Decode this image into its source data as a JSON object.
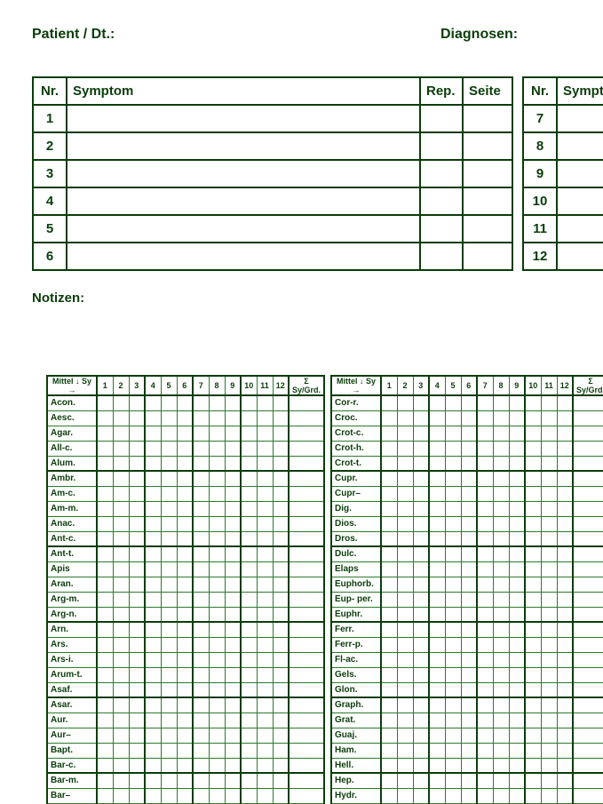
{
  "header": {
    "patient_label": "Patient / Dt.:",
    "diagnosen_label": "Diagnosen:"
  },
  "symptom_table": {
    "headers": {
      "nr": "Nr.",
      "symptom": "Symptom",
      "rep": "Rep.",
      "seite": "Seite"
    },
    "left_rows": [
      "1",
      "2",
      "3",
      "4",
      "5",
      "6"
    ],
    "right_rows": [
      "7",
      "8",
      "9",
      "10",
      "11",
      "12"
    ]
  },
  "notes_label": "Notizen:",
  "remedy": {
    "col_header_name": "Mittel ↓ Sy →",
    "num_headers": [
      "1",
      "2",
      "3",
      "4",
      "5",
      "6",
      "7",
      "8",
      "9",
      "10",
      "11",
      "12"
    ],
    "sum_header": "Σ Sy/Grd.",
    "col1": [
      "Acon.",
      "Aesc.",
      "Agar.",
      "All-c.",
      "Alum.",
      "Ambr.",
      "Am-c.",
      "Am-m.",
      "Anac.",
      "Ant-c.",
      "Ant-t.",
      "Apis",
      "Aran.",
      "Arg-m.",
      "Arg-n.",
      "Arn.",
      "Ars.",
      "Ars-i.",
      "Arum-t.",
      "Asaf.",
      "Asar.",
      "Aur.",
      "Aur–",
      "Bapt.",
      "Bar-c.",
      "Bar-m.",
      "Bar–"
    ],
    "col2": [
      "Cor-r.",
      "Croc.",
      "Crot-c.",
      "Crot-h.",
      "Crot-t.",
      "Cupr.",
      "Cupr–",
      "Dig.",
      "Dios.",
      "Dros.",
      "Dulc.",
      "Elaps",
      "Euphorb.",
      "Eup- per.",
      "Euphr.",
      "Ferr.",
      "Ferr-p.",
      "Fl-ac.",
      "Gels.",
      "Glon.",
      "Graph.",
      "Grat.",
      "Guaj.",
      "Ham.",
      "Hell.",
      "Hep.",
      "Hydr."
    ]
  },
  "group_breaks_rows": [
    5,
    10,
    15,
    20,
    25
  ]
}
